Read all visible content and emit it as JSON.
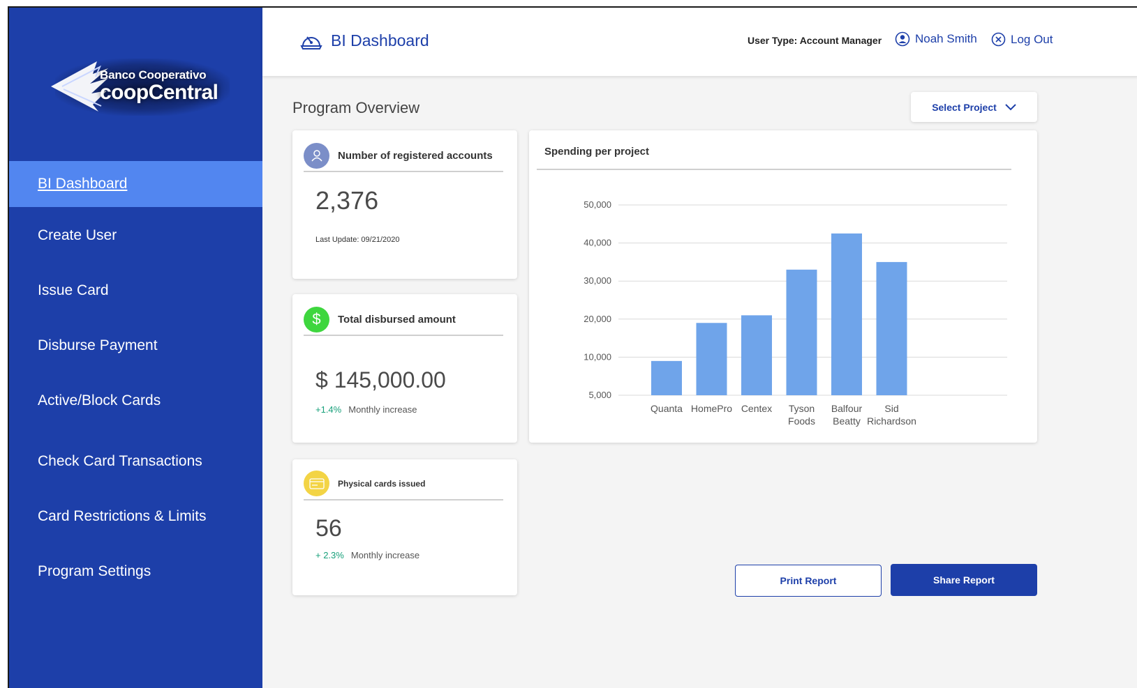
{
  "logo": {
    "line1": "Banco Cooperativo",
    "line2": "coopCentral"
  },
  "sidebar": {
    "items": [
      {
        "label": "BI Dashboard",
        "active": true
      },
      {
        "label": "Create User"
      },
      {
        "label": "Issue Card"
      },
      {
        "label": "Disburse Payment"
      },
      {
        "label": "Active/Block Cards"
      },
      {
        "label": "Check Card Transactions"
      },
      {
        "label": "Card Restrictions & Limits"
      },
      {
        "label": "Program Settings"
      }
    ]
  },
  "header": {
    "title": "BI Dashboard",
    "user_type": "User Type: Account Manager",
    "user_name": "Noah Smith",
    "logout": "Log Out"
  },
  "main": {
    "section_title": "Program Overview",
    "select_project": "Select Project",
    "cards": {
      "accounts": {
        "label": "Number of registered accounts",
        "value": "2,376",
        "last_update": "Last Update: 09/21/2020"
      },
      "disbursed": {
        "label": "Total disbursed amount",
        "value": "$ 145,000.00",
        "change": "+1.4%",
        "change_label": "Monthly increase"
      },
      "physical": {
        "label": "Physical cards issued",
        "value": "56",
        "change": "+ 2.3%",
        "change_label": "Monthly increase"
      }
    },
    "print_report": "Print Report",
    "share_report": "Share Report"
  },
  "colors": {
    "primary": "#1d3fa9",
    "active_nav": "#5286f0",
    "bar": "#6fa4ea",
    "positive": "#17a07a",
    "dollar_icon": "#3ed63e",
    "card_icon": "#f3d445",
    "user_icon": "#7b8ec8"
  },
  "chart_data": {
    "type": "bar",
    "title": "Spending per project",
    "categories": [
      [
        "Quanta"
      ],
      [
        "HomePro"
      ],
      [
        "Centex"
      ],
      [
        "Tyson",
        "Foods"
      ],
      [
        "Balfour",
        "Beatty"
      ],
      [
        "Sid",
        "Richardson"
      ]
    ],
    "values": [
      9500,
      19000,
      21000,
      33000,
      42500,
      35000
    ],
    "yticks": [
      "5,000",
      "10,000",
      "20,000",
      "30,000",
      "40,000",
      "50,000"
    ],
    "ytick_values": [
      5000,
      10000,
      20000,
      30000,
      40000,
      50000
    ],
    "grid": true
  }
}
